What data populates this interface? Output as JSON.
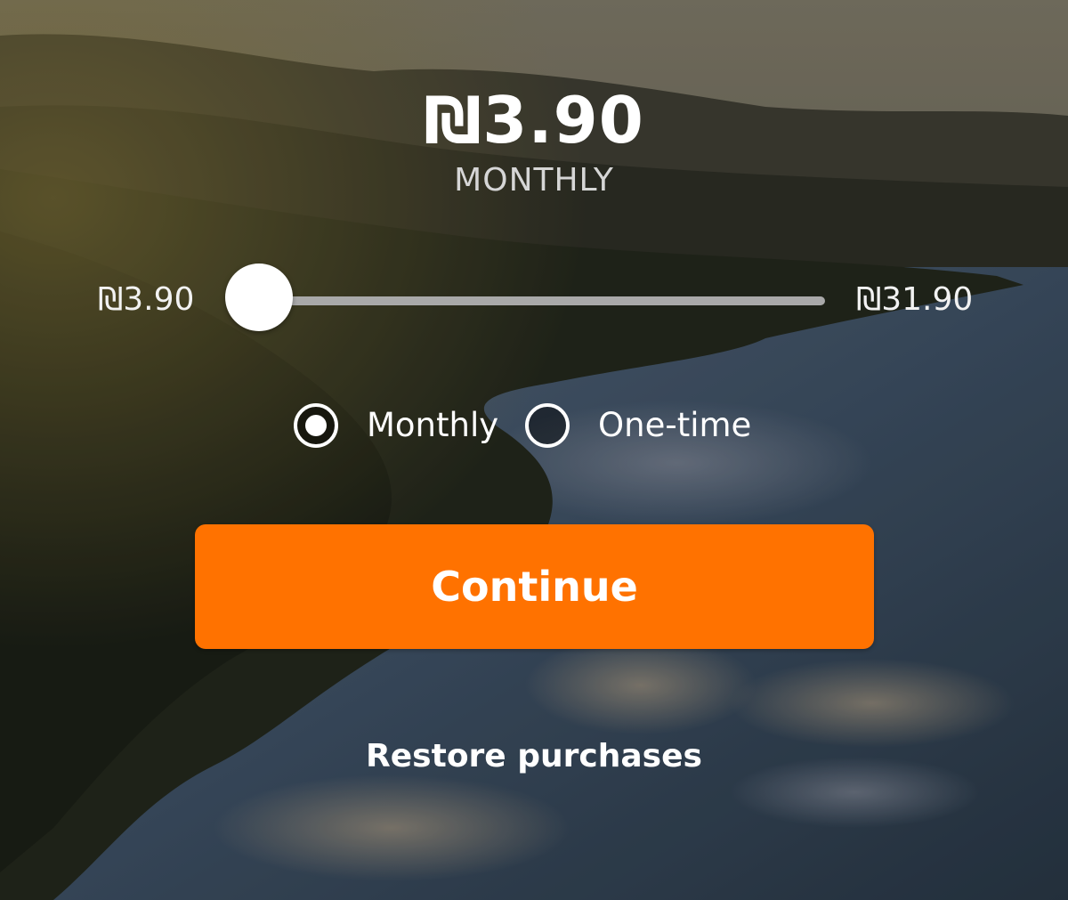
{
  "plan": {
    "price": "₪3.90",
    "period": "MONTHLY"
  },
  "slider": {
    "min_label": "₪3.90",
    "max_label": "₪31.90",
    "min_value": 3.9,
    "max_value": 31.9,
    "value": 3.9
  },
  "billing_options": [
    {
      "label": "Monthly",
      "selected": true
    },
    {
      "label": "One-time",
      "selected": false
    }
  ],
  "continue_button": {
    "label": "Continue"
  },
  "restore": {
    "label": "Restore purchases"
  },
  "colors": {
    "accent": "#ff7200",
    "text": "#ffffff",
    "track": "#a9a9a9"
  },
  "background": {
    "icon": "landscape-lake-photo"
  }
}
